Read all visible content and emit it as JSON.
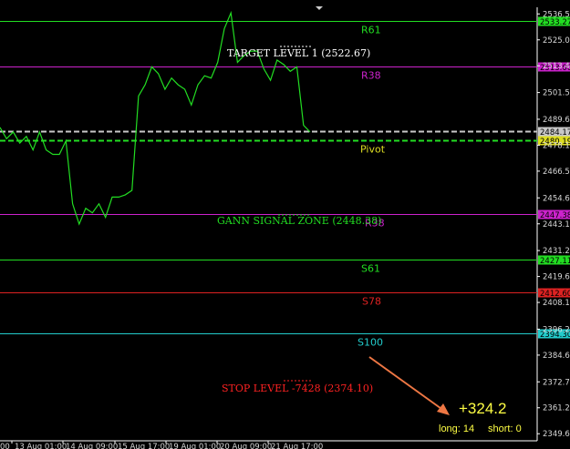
{
  "chart_data": {
    "type": "line",
    "ylim": [
      2346.5,
      2539.5
    ],
    "y_ticks": [
      "2536.55",
      "2525.00",
      "2513.45",
      "2501.55",
      "2489.65",
      "2478.10",
      "2466.55",
      "2454.65",
      "2443.10",
      "2431.20",
      "2419.65",
      "2408.10",
      "2396.20",
      "2384.65",
      "2372.75",
      "2361.20",
      "2349.65"
    ],
    "x_labels": [
      "13 Aug 01:00",
      "14 Aug 09:00",
      "15 Aug 17:00",
      "19 Aug 01:00",
      "20 Aug 09:00",
      "21 Aug 17:00"
    ],
    "x_label_prefix": "00",
    "price_series": [
      2486,
      2481,
      2484,
      2479,
      2482,
      2476,
      2484,
      2476,
      2474,
      2474,
      2480,
      2452,
      2443,
      2450,
      2448,
      2452,
      2446,
      2455,
      2455,
      2456,
      2458,
      2500,
      2505,
      2513,
      2510,
      2503,
      2508,
      2505,
      2503,
      2496,
      2505,
      2509,
      2508,
      2515,
      2530,
      2537,
      2515,
      2518,
      2520,
      2520,
      2512,
      2507,
      2516,
      2514,
      2511,
      2513,
      2487,
      2484
    ],
    "levels": [
      {
        "name": "R61",
        "price": 2533.27,
        "tag": "2533.27",
        "color": "#22dd22",
        "tag_color": "#22dd22"
      },
      {
        "name": "R38",
        "price": 2513.0,
        "tag": "2513.00",
        "color": "#cc22cc",
        "tag_color": "#cc22cc"
      },
      {
        "name": "",
        "price": 2484.17,
        "tag": "2484.17",
        "color": "#c8c8c8",
        "tag_color": "#c8c8c8",
        "dashed": true
      },
      {
        "name": "Pivot",
        "price": 2480.19,
        "tag": "2480.19",
        "color": "#22dd22",
        "tag_color": "#dddd22",
        "dashed": true
      },
      {
        "name": "R38",
        "price": 2447.38,
        "tag": "2447.38",
        "color": "#cc22cc",
        "tag_color": "#cc22cc"
      },
      {
        "name": "S61",
        "price": 2427.11,
        "tag": "2427.11",
        "color": "#22dd22",
        "tag_color": "#22dd22"
      },
      {
        "name": "S78",
        "price": 2412.6,
        "tag": "2412.60",
        "color": "#dd2222",
        "tag_color": "#dd2222"
      },
      {
        "name": "S100",
        "price": 2394.3,
        "tag": "2394.30",
        "color": "#22cccc",
        "tag_color": "#22cccc"
      }
    ]
  },
  "annotations": {
    "target": "TARGET LEVEL 1 (2522.67)",
    "gann": "GANN SIGNAL ZONE (2448.38)",
    "stop": "STOP LEVEL -7428 (2374.10)"
  },
  "stats": {
    "profit": "+324.2",
    "long": "long: 14",
    "short": "short: 0"
  },
  "colors": {
    "price_line": "#22dd22",
    "target_text": "#ffffff",
    "gann_text": "#22dd22",
    "stop_text": "#ff2222",
    "arrow": "#ee7744",
    "profit": "#ffff44",
    "counts": "#ffff44"
  }
}
